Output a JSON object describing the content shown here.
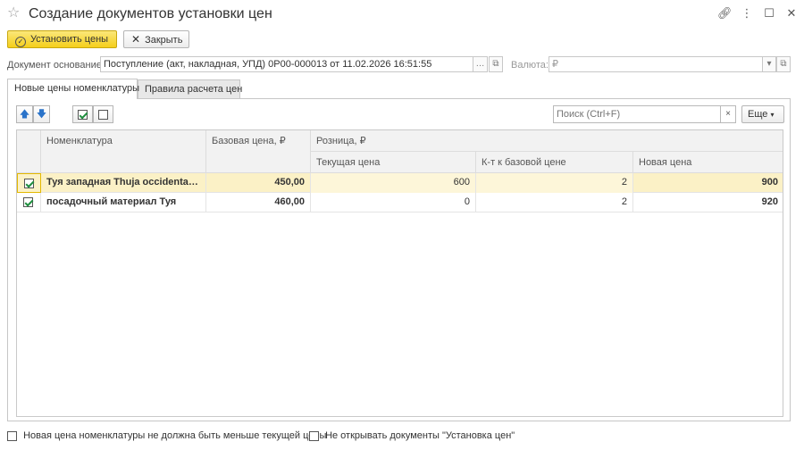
{
  "window": {
    "title": "Создание документов установки цен"
  },
  "toolbar": {
    "set_prices_label": "Установить цены",
    "close_label": "Закрыть"
  },
  "base_doc": {
    "label": "Документ основание:",
    "value": "Поступление (акт, накладная, УПД) 0Р00-000013 от 11.02.2026 16:51:55"
  },
  "currency": {
    "label": "Валюта:",
    "value": "₽"
  },
  "tabs": [
    {
      "label": "Новые цены номенклатуры",
      "active": true
    },
    {
      "label": "Правила расчета цен",
      "active": false
    }
  ],
  "search": {
    "placeholder": "Поиск (Ctrl+F)"
  },
  "more_label": "Еще",
  "table": {
    "headers": {
      "nomenclature": "Номенклатура",
      "base_price": "Базовая цена, ₽",
      "retail": "Розница, ₽",
      "current_price": "Текущая цена",
      "coef": "К-т к базовой цене",
      "new_price": "Новая цена"
    },
    "rows": [
      {
        "checked": true,
        "name": "Туя западная Thuja occidentali...",
        "base_price": "450,00",
        "current_price": "600",
        "coef": "2",
        "new_price": "900"
      },
      {
        "checked": true,
        "name": "посадочный материал Туя",
        "base_price": "460,00",
        "current_price": "0",
        "coef": "2",
        "new_price": "920"
      }
    ]
  },
  "footer": {
    "not_less_label": "Новая цена номенклатуры не должна быть меньше текущей цены",
    "dont_open_label": "Не открывать документы \"Установка цен\""
  },
  "colors": {
    "primary_button": "#f5cf1b",
    "selected_row": "#fbf1c6",
    "check_mark": "#1e8e3e",
    "arrow_buttons": "#2a73c9"
  }
}
